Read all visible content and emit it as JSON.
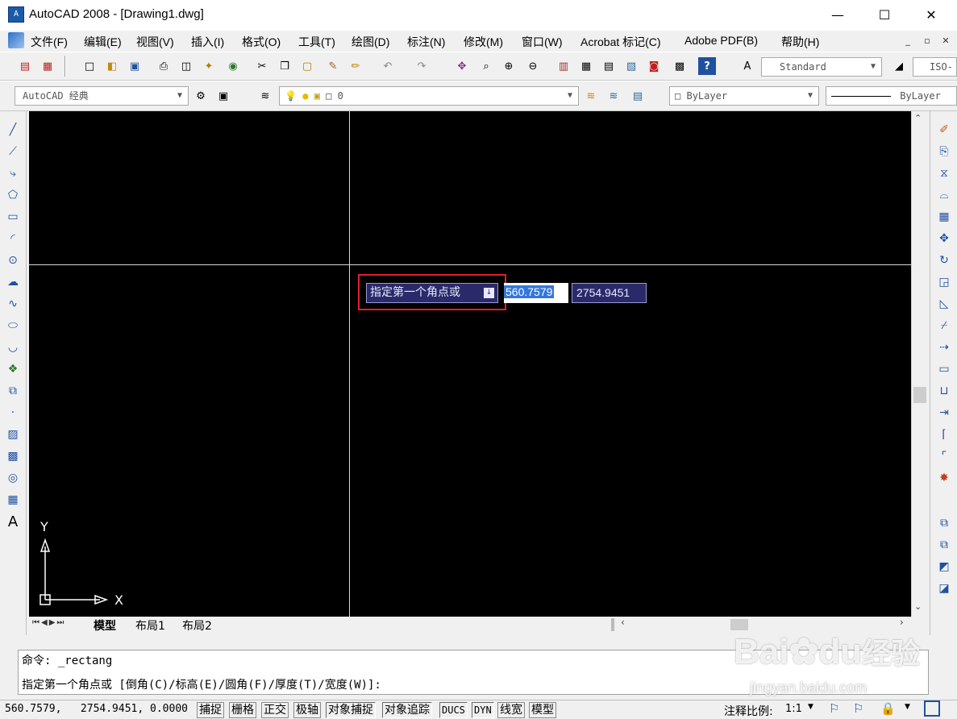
{
  "window": {
    "title": "AutoCAD 2008 - [Drawing1.dwg]",
    "app_icon_text": "A",
    "minimize": "—",
    "maximize": "☐",
    "close": "✕"
  },
  "menu": {
    "items": [
      "文件(F)",
      "编辑(E)",
      "视图(V)",
      "插入(I)",
      "格式(O)",
      "工具(T)",
      "绘图(D)",
      "标注(N)",
      "修改(M)",
      "窗口(W)",
      "Acrobat 标记(C)",
      "Adobe PDF(B)",
      "帮助(H)"
    ],
    "mdi_min": "_",
    "mdi_restore": "▫",
    "mdi_close": "✕"
  },
  "toolbar": {
    "text_style": "Standard",
    "dim_style": "ISO-",
    "workspace": "AutoCAD 经典",
    "layer": "0",
    "color": "ByLayer",
    "linetype": "ByLayer"
  },
  "canvas": {
    "ucs_y": "Y",
    "ucs_x": "X",
    "tabs": [
      "模型",
      "布局1",
      "布局2"
    ]
  },
  "dynamic_input": {
    "prompt": "指定第一个角点或",
    "prompt_arrow": "↓",
    "x_value": "560.7579",
    "y_value": "2754.9451"
  },
  "command": {
    "line1": "命令: _rectang",
    "line2": "指定第一个角点或 [倒角(C)/标高(E)/圆角(F)/厚度(T)/宽度(W)]:"
  },
  "status": {
    "coords": "560.7579,   2754.9451, 0.0000",
    "buttons": [
      "捕捉",
      "栅格",
      "正交",
      "极轴",
      "对象捕捉",
      "对象追踪",
      "DUCS",
      "DYN",
      "线宽",
      "模型"
    ],
    "annotation_scale_label": "注释比例:",
    "annotation_scale_value": "1:1"
  },
  "watermark": {
    "brand": "Bai",
    "brand2": "du",
    "brand_cn": "经验",
    "url": "jingyan.baidu.com"
  },
  "colors": {
    "canvas_bg": "#000000",
    "crosshair": "#ffffff",
    "highlight": "#e0202a",
    "dyn_bg": "#2a2a6a",
    "selection": "#3377dd"
  }
}
